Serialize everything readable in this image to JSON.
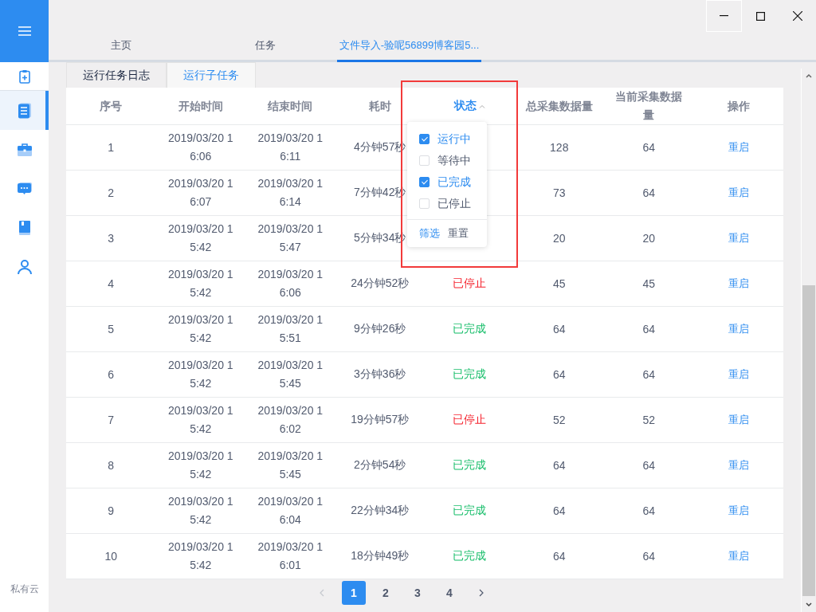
{
  "sidebar": {
    "items": [
      {
        "kind": "clipboard",
        "selected": false
      },
      {
        "kind": "document",
        "selected": true
      },
      {
        "kind": "briefcase",
        "selected": false
      },
      {
        "kind": "chat",
        "selected": false
      },
      {
        "kind": "book",
        "selected": false
      },
      {
        "kind": "user",
        "selected": false
      }
    ],
    "footer": "私有云"
  },
  "tabs": [
    {
      "label": "主页",
      "selected": false
    },
    {
      "label": "任务",
      "selected": false
    },
    {
      "label": "文件导入-验呢56899博客园5...",
      "selected": true
    }
  ],
  "subtabs": [
    {
      "label": "运行任务日志",
      "selected": false
    },
    {
      "label": "运行子任务",
      "selected": true
    }
  ],
  "table": {
    "columns": [
      "序号",
      "开始时间",
      "结束时间",
      "耗时",
      "状态",
      "总采集数据量",
      "当前采集数据量",
      "操作"
    ],
    "rows": [
      {
        "index": "1",
        "start": "2019/03/20 16:06",
        "end": "2019/03/20 16:11",
        "duration": "4分钟57秒",
        "total": "128",
        "current": "64",
        "action": "重启"
      },
      {
        "index": "2",
        "start": "2019/03/20 16:07",
        "end": "2019/03/20 16:14",
        "duration": "7分钟42秒",
        "total": "73",
        "current": "64",
        "action": "重启"
      },
      {
        "index": "3",
        "start": "2019/03/20 15:42",
        "end": "2019/03/20 15:47",
        "duration": "5分钟34秒",
        "total": "20",
        "current": "20",
        "action": "重启"
      },
      {
        "index": "4",
        "start": "2019/03/20 15:42",
        "end": "2019/03/20 16:06",
        "duration": "24分钟52秒",
        "status": {
          "text": "已停止",
          "color": "#f5222d"
        },
        "total": "45",
        "current": "45",
        "action": "重启"
      },
      {
        "index": "5",
        "start": "2019/03/20 15:42",
        "end": "2019/03/20 15:51",
        "duration": "9分钟26秒",
        "status": {
          "text": "已完成",
          "color": "#19be6b"
        },
        "total": "64",
        "current": "64",
        "action": "重启"
      },
      {
        "index": "6",
        "start": "2019/03/20 15:42",
        "end": "2019/03/20 15:45",
        "duration": "3分钟36秒",
        "status": {
          "text": "已完成",
          "color": "#19be6b"
        },
        "total": "64",
        "current": "64",
        "action": "重启"
      },
      {
        "index": "7",
        "start": "2019/03/20 15:42",
        "end": "2019/03/20 16:02",
        "duration": "19分钟57秒",
        "status": {
          "text": "已停止",
          "color": "#f5222d"
        },
        "total": "52",
        "current": "52",
        "action": "重启"
      },
      {
        "index": "8",
        "start": "2019/03/20 15:42",
        "end": "2019/03/20 15:45",
        "duration": "2分钟54秒",
        "status": {
          "text": "已完成",
          "color": "#19be6b"
        },
        "total": "64",
        "current": "64",
        "action": "重启"
      },
      {
        "index": "9",
        "start": "2019/03/20 15:42",
        "end": "2019/03/20 16:04",
        "duration": "22分钟34秒",
        "status": {
          "text": "已完成",
          "color": "#19be6b"
        },
        "total": "64",
        "current": "64",
        "action": "重启"
      },
      {
        "index": "10",
        "start": "2019/03/20 15:42",
        "end": "2019/03/20 16:01",
        "duration": "18分钟49秒",
        "status": {
          "text": "已完成",
          "color": "#19be6b"
        },
        "total": "64",
        "current": "64",
        "action": "重启"
      }
    ]
  },
  "filter_menu": {
    "options": [
      {
        "label": "运行中",
        "checked": true
      },
      {
        "label": "等待中",
        "checked": false
      },
      {
        "label": "已完成",
        "checked": true
      },
      {
        "label": "已停止",
        "checked": false
      }
    ],
    "buttons": [
      "筛选",
      "重置"
    ]
  },
  "pagination": {
    "pages": [
      {
        "label": "1",
        "selected": true
      },
      {
        "label": "2",
        "selected": false
      },
      {
        "label": "3",
        "selected": false
      },
      {
        "label": "4",
        "selected": false
      }
    ]
  }
}
